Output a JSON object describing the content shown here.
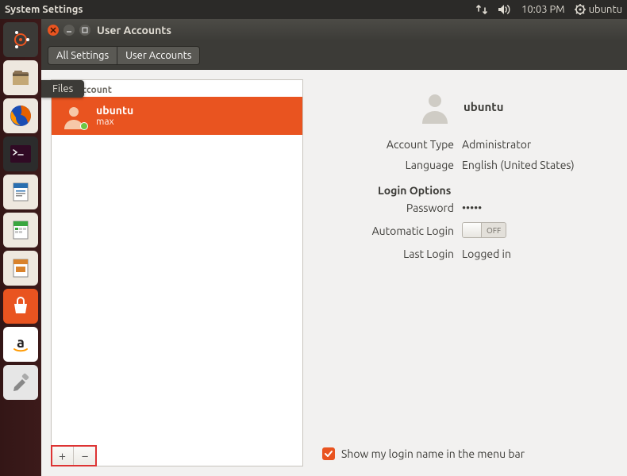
{
  "menubar": {
    "title": "System Settings",
    "clock": "10:03 PM",
    "session_user": "ubuntu"
  },
  "launcher": {
    "tooltip": "Files"
  },
  "window": {
    "title": "User Accounts",
    "breadcrumb": {
      "all": "All Settings",
      "current": "User Accounts"
    }
  },
  "accounts": {
    "section_label": "My Account",
    "selected": {
      "display_name": "ubuntu",
      "real_name": "max"
    },
    "buttons": {
      "add": "+",
      "remove": "−"
    }
  },
  "details": {
    "username": "ubuntu",
    "labels": {
      "account_type": "Account Type",
      "language": "Language",
      "login_options": "Login Options",
      "password": "Password",
      "automatic_login": "Automatic Login",
      "last_login": "Last Login"
    },
    "values": {
      "account_type": "Administrator",
      "language": "English (United States)",
      "password": "•••••",
      "automatic_login_state": "OFF",
      "last_login": "Logged in"
    },
    "show_login_name": "Show my login name in the menu bar"
  }
}
